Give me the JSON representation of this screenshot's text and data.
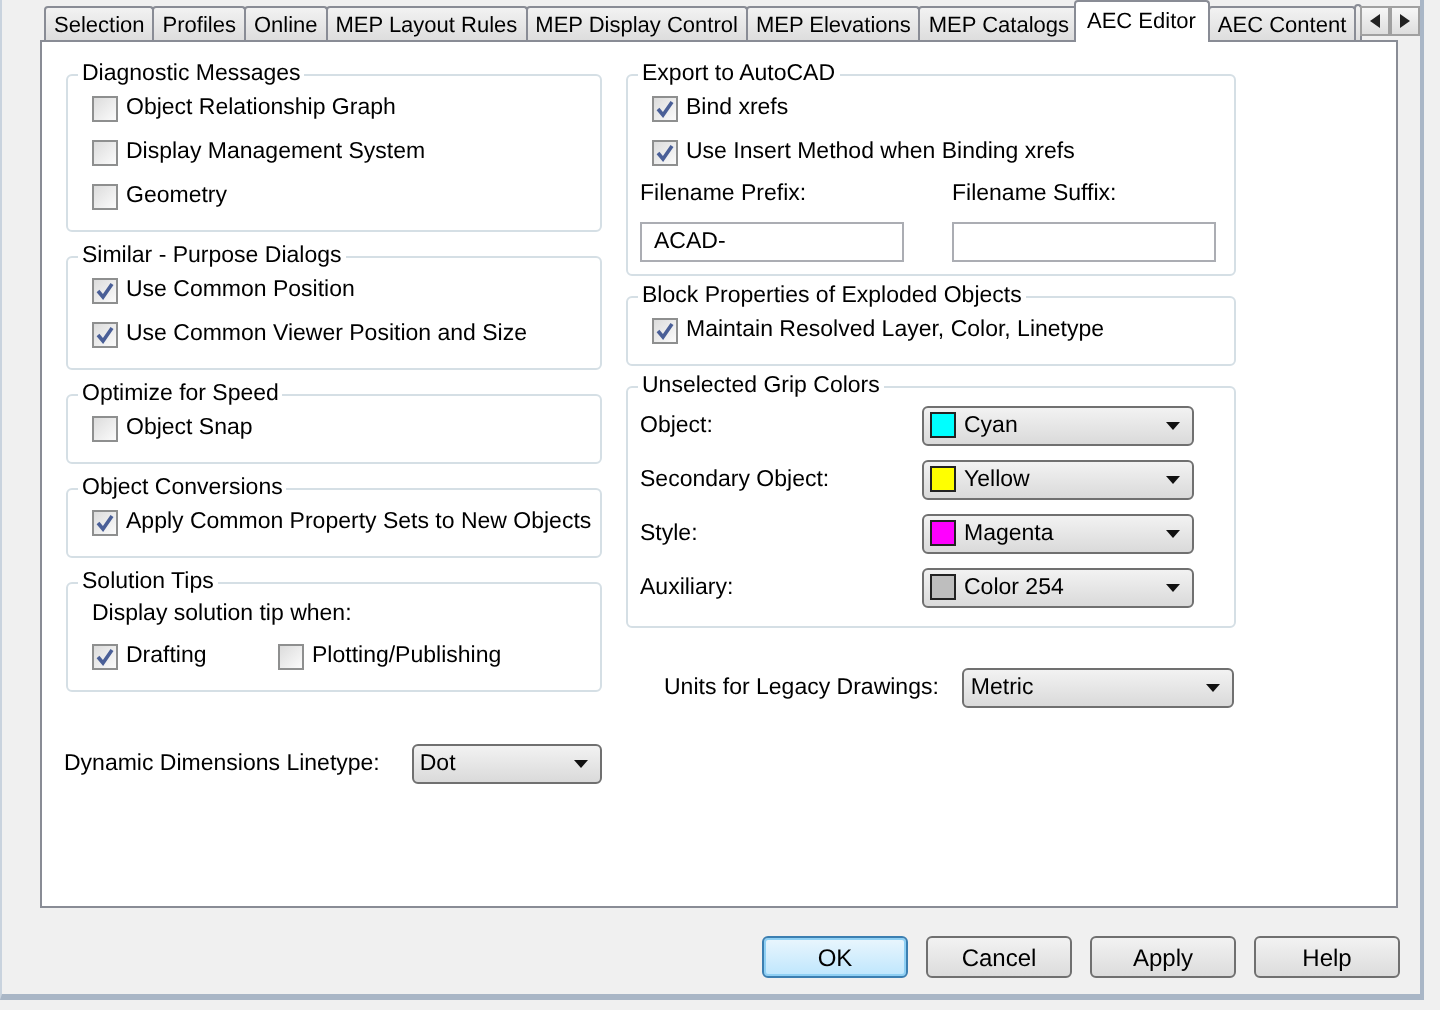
{
  "tabs": [
    {
      "label": "Selection",
      "selected": false
    },
    {
      "label": "Profiles",
      "selected": false
    },
    {
      "label": "Online",
      "selected": false
    },
    {
      "label": "MEP Layout Rules",
      "selected": false
    },
    {
      "label": "MEP Display Control",
      "selected": false
    },
    {
      "label": "MEP Elevations",
      "selected": false
    },
    {
      "label": "MEP Catalogs",
      "selected": false
    },
    {
      "label": "AEC Editor",
      "selected": true
    },
    {
      "label": "AEC Content",
      "selected": false
    }
  ],
  "left_column": {
    "groups": [
      {
        "title": "Diagnostic Messages",
        "rows": [
          {
            "kind": "checkbox",
            "label": "Object Relationship Graph",
            "checked": false
          },
          {
            "kind": "checkbox",
            "label": "Display Management System",
            "checked": false
          },
          {
            "kind": "checkbox",
            "label": "Geometry",
            "checked": false
          }
        ]
      },
      {
        "title": "Similar - Purpose Dialogs",
        "rows": [
          {
            "kind": "checkbox",
            "label": "Use Common Position",
            "checked": true
          },
          {
            "kind": "checkbox",
            "label": "Use Common Viewer Position and Size",
            "checked": true
          }
        ]
      },
      {
        "title": "Optimize for Speed",
        "rows": [
          {
            "kind": "checkbox",
            "label": "Object Snap",
            "checked": false
          }
        ]
      },
      {
        "title": "Object Conversions",
        "rows": [
          {
            "kind": "checkbox",
            "label": "Apply Common Property Sets to New Objects",
            "checked": true
          }
        ]
      },
      {
        "title": "Solution Tips",
        "rows": [
          {
            "kind": "caption",
            "text": "Display solution tip when:"
          },
          {
            "kind": "checkbox_pair",
            "items": [
              {
                "label": "Drafting",
                "checked": true
              },
              {
                "label": "Plotting/Publishing",
                "checked": false
              }
            ]
          }
        ]
      }
    ],
    "dropdown": {
      "label": "Dynamic Dimensions Linetype:",
      "value": "Dot"
    }
  },
  "right_column": {
    "groups": [
      {
        "title": "Export to AutoCAD",
        "rows": [
          {
            "kind": "checkbox",
            "label": "Bind xrefs",
            "checked": true
          },
          {
            "kind": "checkbox",
            "label": "Use Insert Method when Binding xrefs",
            "checked": true
          },
          {
            "kind": "fields",
            "fields": [
              {
                "label": "Filename Prefix:",
                "value": "ACAD-"
              },
              {
                "label": "Filename Suffix:"
              }
            ]
          }
        ]
      },
      {
        "title": "Block Properties of Exploded Objects",
        "rows": [
          {
            "kind": "checkbox",
            "label": "Maintain Resolved Layer, Color, Linetype",
            "checked": true
          }
        ]
      },
      {
        "title": "Unselected Grip Colors",
        "rows": [
          {
            "kind": "color_select",
            "label": "Object:",
            "value": "Cyan",
            "color": "#00ffff"
          },
          {
            "kind": "color_select",
            "label": "Secondary Object:",
            "value": "Yellow",
            "color": "#ffff00"
          },
          {
            "kind": "color_select",
            "label": "Style:",
            "value": "Magenta",
            "color": "#ff00ff"
          },
          {
            "kind": "color_select",
            "label": "Auxiliary:",
            "value": "Color 254",
            "color": "#bebebe"
          }
        ]
      }
    ],
    "dropdown": {
      "label": "Units for Legacy Drawings:",
      "value": "Metric"
    }
  },
  "buttons": [
    {
      "label": "OK",
      "default": true
    },
    {
      "label": "Cancel",
      "default": false
    },
    {
      "label": "Apply",
      "default": false
    },
    {
      "label": "Help",
      "default": false
    }
  ]
}
